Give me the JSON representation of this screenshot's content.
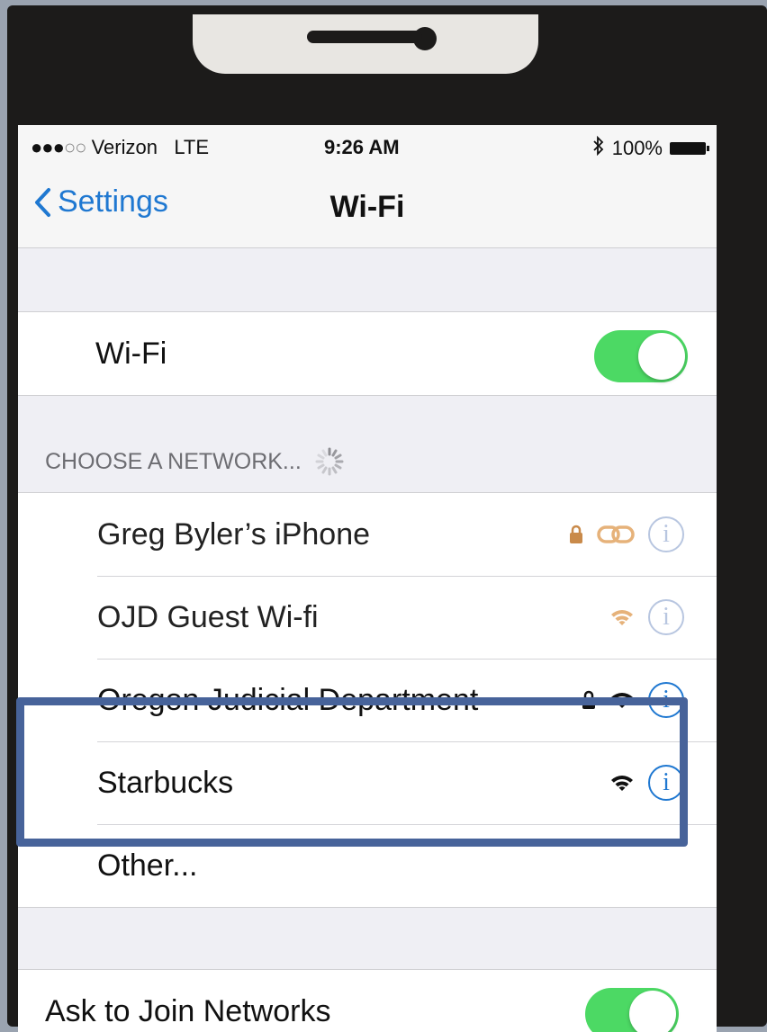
{
  "status_bar": {
    "carrier": "Verizon",
    "network": "LTE",
    "time": "9:26 AM",
    "battery": "100%",
    "signal_bars_filled": 3,
    "signal_bars_total": 5
  },
  "nav": {
    "back_label": "Settings",
    "title": "Wi-Fi"
  },
  "wifi_toggle": {
    "label": "Wi-Fi",
    "on": true
  },
  "section": {
    "header": "CHOOSE A NETWORK..."
  },
  "networks": [
    {
      "name": "Greg Byler’s iPhone",
      "secured": true,
      "icon": "personal-hotspot-icon"
    },
    {
      "name": "OJD Guest Wi-fi",
      "secured": false,
      "icon": "wifi-signal-icon"
    },
    {
      "name": "Oregon Judicial Department",
      "secured": true,
      "icon": "wifi-signal-icon"
    },
    {
      "name": "Starbucks",
      "secured": false,
      "icon": "wifi-signal-icon"
    }
  ],
  "other": {
    "label": "Other..."
  },
  "ask_to_join": {
    "label": "Ask to Join Networks",
    "on": true
  },
  "colors": {
    "accent": "#1f78d1",
    "toggle_on": "#4cd964",
    "highlight_box": "#47639a"
  }
}
